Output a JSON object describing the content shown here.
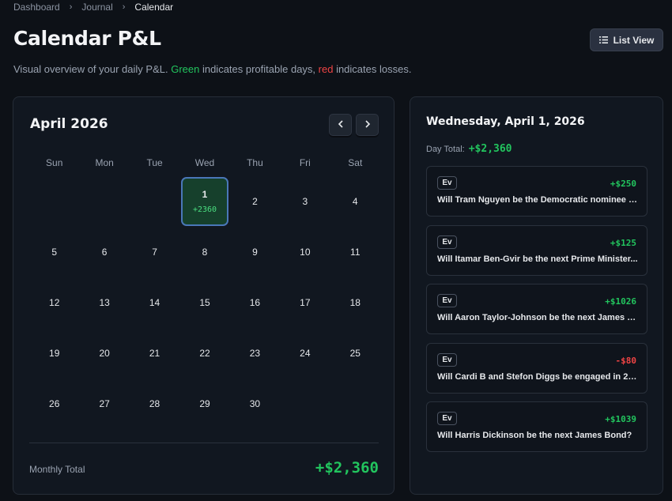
{
  "breadcrumb": [
    "Dashboard",
    "Journal",
    "Calendar"
  ],
  "title": "Calendar P&L",
  "list_view_label": "List View",
  "subtitle": {
    "prefix": "Visual overview of your daily P&L. ",
    "green_word": "Green",
    "middle": " indicates profitable days, ",
    "red_word": "red",
    "suffix": " indicates losses."
  },
  "calendar": {
    "month_label": "April 2026",
    "weekdays": [
      "Sun",
      "Mon",
      "Tue",
      "Wed",
      "Thu",
      "Fri",
      "Sat"
    ],
    "leading_blank_days": 3,
    "days": [
      {
        "day": "1",
        "pnl": "+2360",
        "selected": true
      },
      {
        "day": "2"
      },
      {
        "day": "3"
      },
      {
        "day": "4"
      },
      {
        "day": "5"
      },
      {
        "day": "6"
      },
      {
        "day": "7"
      },
      {
        "day": "8"
      },
      {
        "day": "9"
      },
      {
        "day": "10"
      },
      {
        "day": "11"
      },
      {
        "day": "12"
      },
      {
        "day": "13"
      },
      {
        "day": "14"
      },
      {
        "day": "15"
      },
      {
        "day": "16"
      },
      {
        "day": "17"
      },
      {
        "day": "18"
      },
      {
        "day": "19"
      },
      {
        "day": "20"
      },
      {
        "day": "21"
      },
      {
        "day": "22"
      },
      {
        "day": "23"
      },
      {
        "day": "24"
      },
      {
        "day": "25"
      },
      {
        "day": "26"
      },
      {
        "day": "27"
      },
      {
        "day": "28"
      },
      {
        "day": "29"
      },
      {
        "day": "30"
      }
    ],
    "monthly_total_label": "Monthly Total",
    "monthly_total_value": "+$2,360"
  },
  "day_detail": {
    "title": "Wednesday, April 1, 2026",
    "total_label": "Day Total:",
    "total_value": "+$2,360",
    "trades": [
      {
        "tag": "Ev",
        "amount": "+$250",
        "sign": "pos",
        "question": "Will Tram Nguyen be the Democratic nominee for..."
      },
      {
        "tag": "Ev",
        "amount": "+$125",
        "sign": "pos",
        "question": "Will Itamar Ben-Gvir be the next Prime Minister..."
      },
      {
        "tag": "Ev",
        "amount": "+$1026",
        "sign": "pos",
        "question": "Will Aaron Taylor-Johnson be the next James Bond?"
      },
      {
        "tag": "Ev",
        "amount": "-$80",
        "sign": "neg",
        "question": "Will Cardi B and Stefon Diggs be engaged in 2026?"
      },
      {
        "tag": "Ev",
        "amount": "+$1039",
        "sign": "pos",
        "question": "Will Harris Dickinson be the next James Bond?"
      }
    ]
  },
  "colors": {
    "profit": "#22c55e",
    "loss": "#ef4444",
    "selected_border": "#4a77b8"
  }
}
